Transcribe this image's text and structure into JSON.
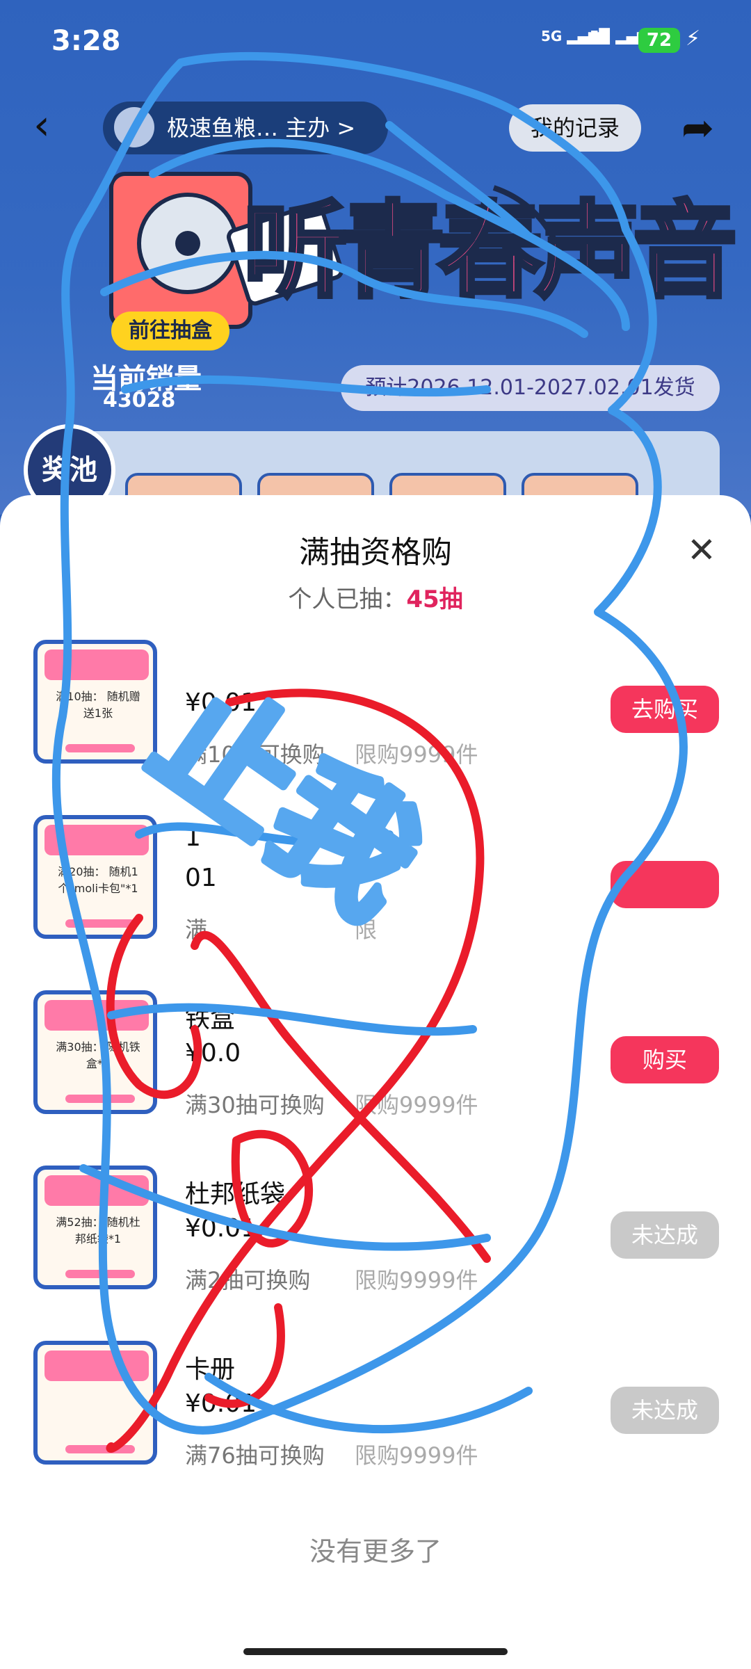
{
  "status_bar": {
    "time": "3:28",
    "signal_1": "5G",
    "signal_2": "5G",
    "battery": "72"
  },
  "header": {
    "shop_name": "极速鱼粮… 主办 >",
    "record_button": "我的记录",
    "banner_title": "听青春声音",
    "enter_badge": "前往抽盒",
    "sales_label": "当前销量",
    "sales_value": "43028",
    "ship_period": "预计2026.12.01-2027.02.01发货",
    "pool_badge": "奖池"
  },
  "sheet": {
    "title": "满抽资格购",
    "subtitle_prefix": "个人已抽：",
    "subtitle_count": "45抽",
    "close_icon": "close-icon",
    "items": [
      {
        "name": "",
        "price": "¥0.01",
        "condition": "满10抽可换购",
        "limit": "限购9999件",
        "button": "去购买",
        "state": "available",
        "thumb_text": "满10抽：\n随机赠送1张"
      },
      {
        "name": "1",
        "price": "01",
        "condition": "满",
        "limit": "限",
        "button": "",
        "state": "available",
        "thumb_text": "满20抽：\n随机1个\"moli卡包\"*1"
      },
      {
        "name": "铁盒",
        "price": "¥0.0",
        "condition": "满30抽可换购",
        "limit": "限购9999件",
        "button": "购买",
        "state": "available",
        "thumb_text": "满30抽：\n随机铁盒*1"
      },
      {
        "name": "杜邦纸袋",
        "price": "¥0.01",
        "condition": "满2抽可换购",
        "limit": "限购9999件",
        "button": "未达成",
        "state": "locked",
        "thumb_text": "满52抽：\n随机杜邦纸袋*1"
      },
      {
        "name": "卡册",
        "price": "¥0.01",
        "condition": "满76抽可换购",
        "limit": "限购9999件",
        "button": "未达成",
        "state": "locked",
        "thumb_text": ""
      }
    ],
    "no_more": "没有更多了"
  },
  "overlay": {
    "stamp_text": "止我"
  },
  "colors": {
    "accent": "#f5365c",
    "header_blue": "#2f63be",
    "disabled": "#c9c9c9",
    "count": "#e0245e",
    "scribble_blue": "#3d97ea",
    "scribble_red": "#ea1c2a"
  }
}
